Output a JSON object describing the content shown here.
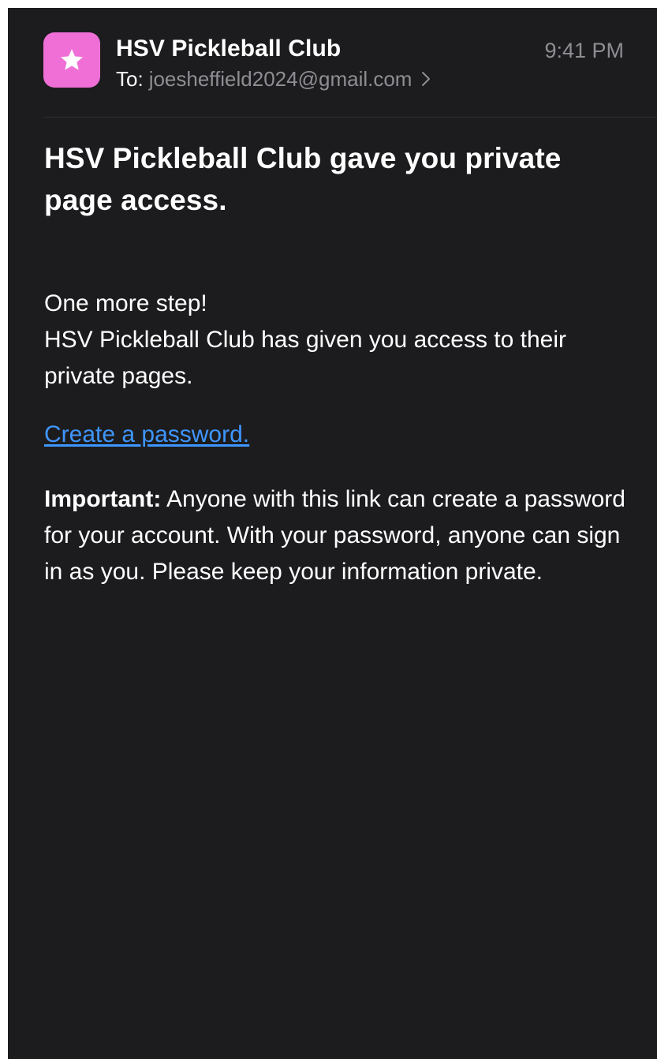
{
  "header": {
    "sender_name": "HSV Pickleball Club",
    "to_label": "To:",
    "to_address": "joesheffield2024@gmail.com",
    "time": "9:41 PM",
    "avatar_icon": "star-icon",
    "avatar_color": "#ef6fd6"
  },
  "email": {
    "subject": "HSV Pickleball Club gave you private page access.",
    "intro_line1": "One more step!",
    "intro_line2": "HSV Pickleball Club has given you access to their private pages.",
    "link_text": "Create a password.",
    "important_label": "Important:",
    "important_text": "Anyone with this link can create a password for your account. With your password, anyone can sign in as you. Please keep your information private."
  },
  "colors": {
    "background": "#1c1c1e",
    "link": "#3f96ff",
    "secondary_text": "#8e8e93"
  }
}
